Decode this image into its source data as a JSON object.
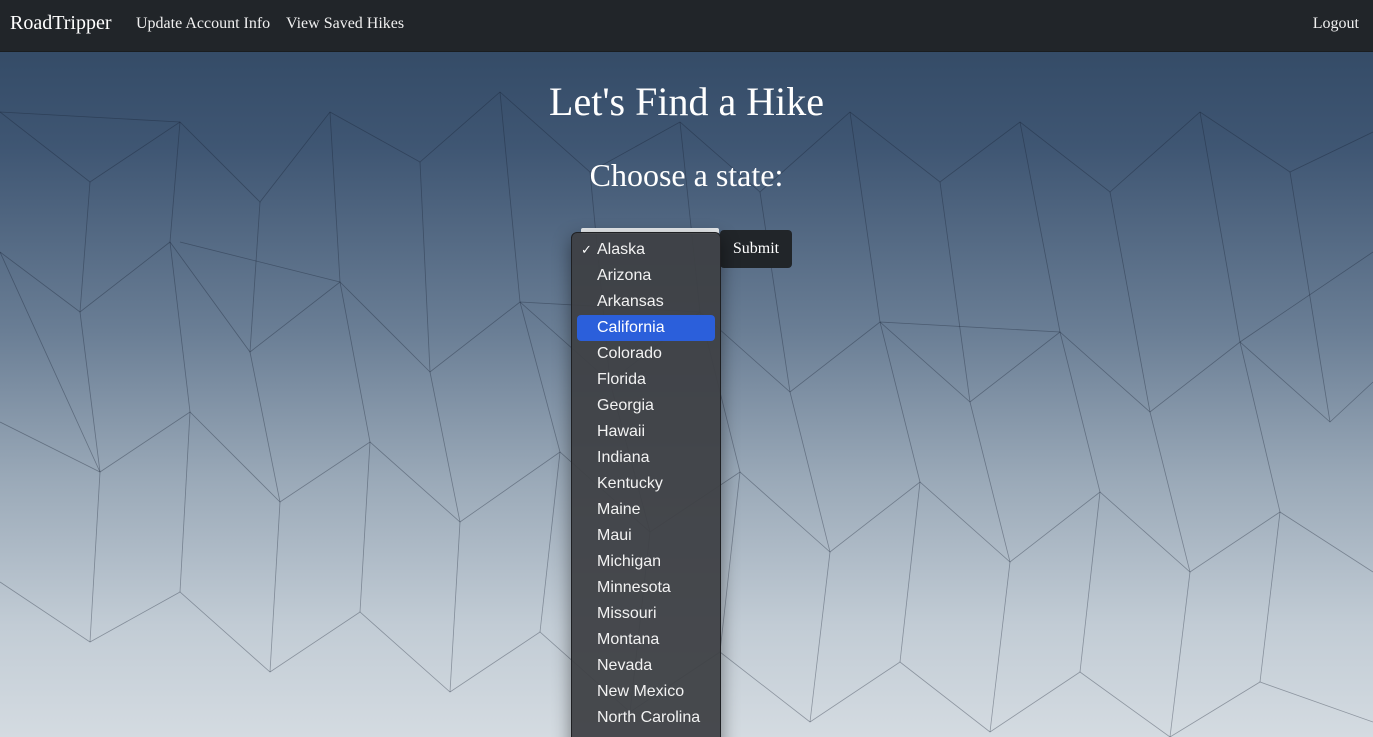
{
  "navbar": {
    "brand": "RoadTripper",
    "links": [
      "Update Account Info",
      "View Saved Hikes"
    ],
    "logout": "Logout"
  },
  "main": {
    "title": "Let's Find a Hike",
    "prompt": "Choose a state:",
    "submit_label": "Submit"
  },
  "dropdown": {
    "selected": "Alaska",
    "highlighted": "California",
    "check_glyph": "✓",
    "options": [
      "Alaska",
      "Arizona",
      "Arkansas",
      "California",
      "Colorado",
      "Florida",
      "Georgia",
      "Hawaii",
      "Indiana",
      "Kentucky",
      "Maine",
      "Maui",
      "Michigan",
      "Minnesota",
      "Missouri",
      "Montana",
      "Nevada",
      "New Mexico",
      "North Carolina"
    ]
  },
  "colors": {
    "navbar": "#212529",
    "highlight": "#2b5fdb",
    "bg_top": "#2f4661",
    "bg_bottom": "#d4dbe1"
  }
}
